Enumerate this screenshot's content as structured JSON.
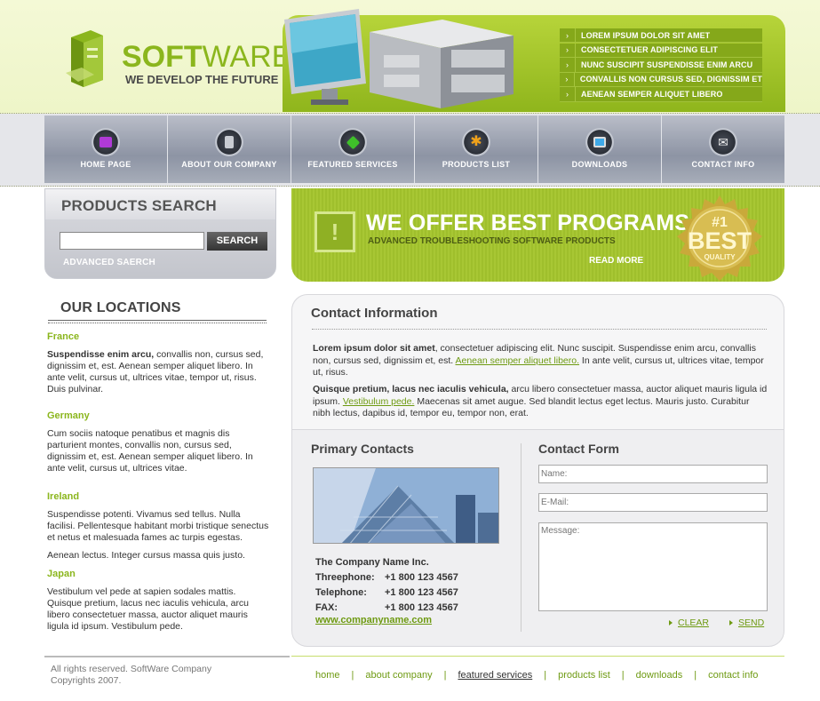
{
  "logo": {
    "title_bold": "SOFT",
    "title_light": "WARE",
    "tagline": "WE DEVELOP THE FUTURE"
  },
  "header_links": [
    "LOREM IPSUM DOLOR SIT AMET",
    "CONSECTETUER ADIPISCING ELIT",
    "NUNC SUSCIPIT SUSPENDISSE ENIM ARCU",
    "CONVALLIS NON CURSUS SED, DIGNISSIM ET",
    "AENEAN SEMPER ALIQUET LIBERO"
  ],
  "nav": [
    {
      "label": "HOME PAGE",
      "icon": "folder-icon",
      "color": "#b03ad6"
    },
    {
      "label": "ABOUT OUR COMPANY",
      "icon": "book-icon",
      "color": "#9aa0aa"
    },
    {
      "label": "FEATURED SERVICES",
      "icon": "diamond-icon",
      "color": "#3fbf2a"
    },
    {
      "label": "PRODUCTS LIST",
      "icon": "star-icon",
      "color": "#f0a21a"
    },
    {
      "label": "DOWNLOADS",
      "icon": "monitor-icon",
      "color": "#3fa9e8"
    },
    {
      "label": "CONTACT INFO",
      "icon": "envelope-icon",
      "color": "#e8e8e8"
    }
  ],
  "search": {
    "title": "PRODUCTS SEARCH",
    "button": "SEARCH",
    "advanced": "ADVANCED SAERCH",
    "value": ""
  },
  "banner": {
    "title": "WE OFFER BEST PROGRAMS",
    "subtitle": "ADVANCED TROUBLESHOOTING SOFTWARE PRODUCTS",
    "more": "READ MORE",
    "seal": {
      "rank": "#1",
      "word": "BEST",
      "caption": "QUALITY"
    }
  },
  "locations": {
    "title": "OUR LOCATIONS",
    "items": [
      {
        "name": "France",
        "bold": "Suspendisse enim arcu,",
        "text": " convallis non, cursus sed, dignissim et, est. Aenean semper aliquet libero. In ante velit, cursus ut, ultrices vitae, tempor ut, risus. Duis pulvinar."
      },
      {
        "name": "Germany",
        "text": "Cum sociis natoque penatibus et magnis dis parturient montes, convallis non, cursus sed, dignissim et, est. Aenean semper aliquet libero. In ante velit, cursus ut, ultrices vitae."
      },
      {
        "name": "Ireland",
        "text": "Suspendisse potenti. Vivamus sed tellus. Nulla facilisi. Pellentesque habitant morbi tristique senectus et netus et malesuada fames ac turpis egestas.",
        "text2": "Aenean lectus. Integer cursus massa quis justo."
      },
      {
        "name": "Japan",
        "text": "Vestibulum vel pede at sapien sodales mattis. Quisque pretium, lacus nec iaculis vehicula, arcu libero consectetuer massa, auctor aliquet mauris ligula id ipsum. Vestibulum pede."
      }
    ]
  },
  "contact_info": {
    "title": "Contact Information",
    "p1_bold": "Lorem ipsum dolor sit amet",
    "p1_a": ", consectetuer adipiscing elit. Nunc suscipit. Suspendisse enim arcu, convallis non, cursus sed, dignissim et, est. ",
    "p1_link": "Aenean semper aliquet libero.",
    "p1_b": " In ante velit, cursus ut, ultrices vitae, tempor ut, risus.",
    "p2_bold": "Quisque pretium, lacus nec iaculis vehicula,",
    "p2_a": " arcu libero consectetuer massa, auctor aliquet mauris ligula id ipsum. ",
    "p2_link": "Vestibulum pede.",
    "p2_b": " Maecenas sit amet augue. Sed blandit lectus eget lectus. Mauris justo. Curabitur nibh lectus, dapibus id, tempor eu, tempor non, erat."
  },
  "primary_contacts": {
    "title": "Primary Contacts",
    "company": "The Company Name Inc.",
    "rows": [
      {
        "label": "Threephone:",
        "value": "+1 800 123 4567"
      },
      {
        "label": "Telephone:",
        "value": "+1 800 123 4567"
      },
      {
        "label": "FAX:",
        "value": "+1 800 123 4567"
      }
    ],
    "website": "www.companyname.com"
  },
  "contact_form": {
    "title": "Contact Form",
    "name_placeholder": "Name:",
    "email_placeholder": "E-Mail:",
    "message_placeholder": "Message:",
    "clear": "CLEAR",
    "send": "SEND"
  },
  "footer": {
    "copyright_line1": "All rights reserved. SoftWare Company",
    "copyright_line2": "Copyrights 2007.",
    "links": [
      "home",
      "about company",
      "featured services",
      "products list",
      "downloads",
      "contact info"
    ],
    "active_index": 2
  },
  "colors": {
    "accent": "#8bb61d",
    "link": "#6e9a12",
    "nav": "#9aa0ad"
  }
}
